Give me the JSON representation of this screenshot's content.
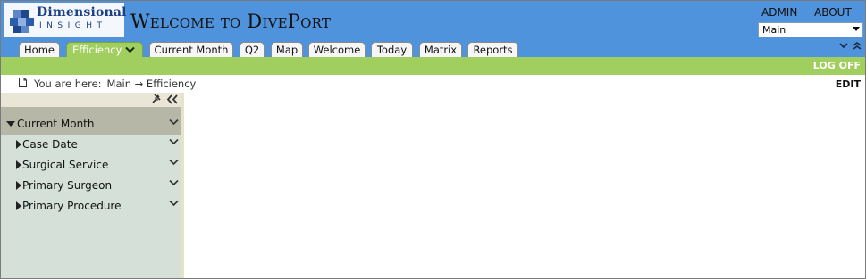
{
  "header": {
    "logo_top": "Dimensional",
    "logo_bottom": "INSIGHT",
    "title": "Welcome to DivePort",
    "links": {
      "admin": "ADMIN",
      "about": "ABOUT"
    },
    "select": {
      "value": "Main"
    }
  },
  "tabs": [
    {
      "label": "Home"
    },
    {
      "label": "Efficiency"
    },
    {
      "label": "Current Month"
    },
    {
      "label": "Q2"
    },
    {
      "label": "Map"
    },
    {
      "label": "Welcome"
    },
    {
      "label": "Today"
    },
    {
      "label": "Matrix"
    },
    {
      "label": "Reports"
    }
  ],
  "bar": {
    "logoff": "LOG OFF"
  },
  "breadcrumb": {
    "prefix": "You are here:",
    "path": "Main → Efficiency",
    "edit": "EDIT"
  },
  "panel": {
    "group": "Current Month",
    "items": [
      {
        "label": "Case Date"
      },
      {
        "label": "Surgical Service"
      },
      {
        "label": "Primary Surgeon"
      },
      {
        "label": "Primary Procedure"
      }
    ]
  },
  "colors": {
    "header_bg": "#4f93dc",
    "accent_green": "#a1cf5f",
    "panel_bg": "#d5e1d8",
    "panel_group": "#b6b7a7"
  }
}
